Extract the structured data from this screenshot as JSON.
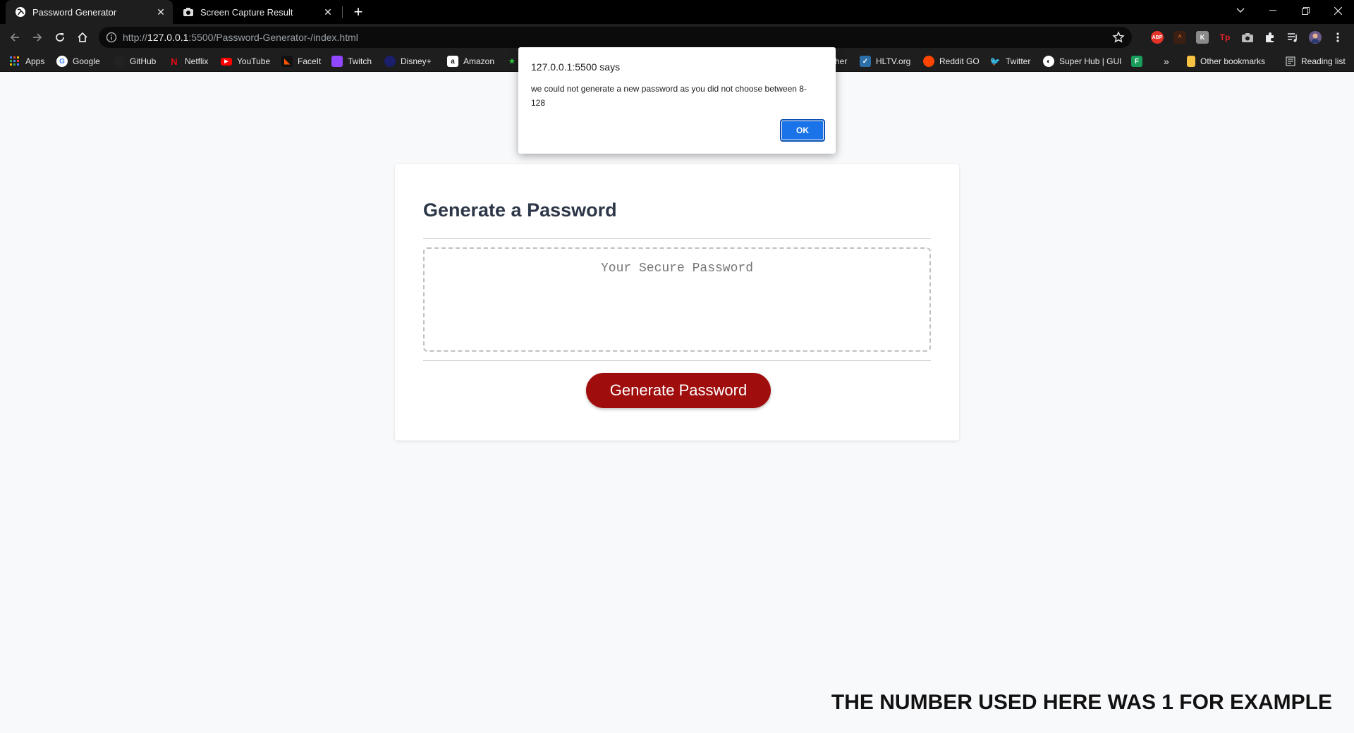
{
  "browser": {
    "tabs": [
      {
        "title": "Password Generator",
        "icon": "globe-icon",
        "active": true
      },
      {
        "title": "Screen Capture Result",
        "icon": "camera-icon",
        "active": false
      }
    ],
    "new_tab_label": "+",
    "address": {
      "scheme": "http://",
      "host": "127.0.0.1",
      "rest": ":5500/Password-Generator-/index.html"
    },
    "bookmarks": [
      {
        "label": "Apps",
        "icon": "apps-grid-icon"
      },
      {
        "label": "Google",
        "icon": "google-icon"
      },
      {
        "label": "GitHub",
        "icon": "github-icon"
      },
      {
        "label": "Netflix",
        "icon": "netflix-icon"
      },
      {
        "label": "YouTube",
        "icon": "youtube-icon"
      },
      {
        "label": "FaceIt",
        "icon": "faceit-icon"
      },
      {
        "label": "Twitch",
        "icon": "twitch-icon"
      },
      {
        "label": "Disney+",
        "icon": "disney-icon"
      },
      {
        "label": "Amazon",
        "icon": "amazon-icon"
      },
      {
        "label": "her",
        "icon": ""
      },
      {
        "label": "HLTV.org",
        "icon": "hltv-icon"
      },
      {
        "label": "Reddit GO",
        "icon": "reddit-icon"
      },
      {
        "label": "Twitter",
        "icon": "twitter-icon"
      },
      {
        "label": "Super Hub | GUI",
        "icon": "globe-icon"
      }
    ],
    "overflow_label": "»",
    "other_bookmarks": "Other bookmarks",
    "reading_list": "Reading list",
    "extensions": [
      {
        "label": "ABP",
        "color": "#e5332a"
      },
      {
        "label": "^",
        "color": "#3a1f12"
      },
      {
        "label": "K",
        "color": "#8a8a8a"
      },
      {
        "label": "Tp",
        "color": "#e62429"
      }
    ]
  },
  "page": {
    "heading": "Generate a Password",
    "password_placeholder": "Your Secure Password",
    "generate_button": "Generate Password",
    "note": "THE NUMBER USED HERE WAS 1 FOR EXAMPLE"
  },
  "alert": {
    "title": "127.0.0.1:5500 says",
    "message": "we could not generate a new password as you did not choose between 8-128",
    "ok_label": "OK"
  },
  "colors": {
    "accent": "#a00d0d",
    "dialog_button": "#1a73e8"
  }
}
